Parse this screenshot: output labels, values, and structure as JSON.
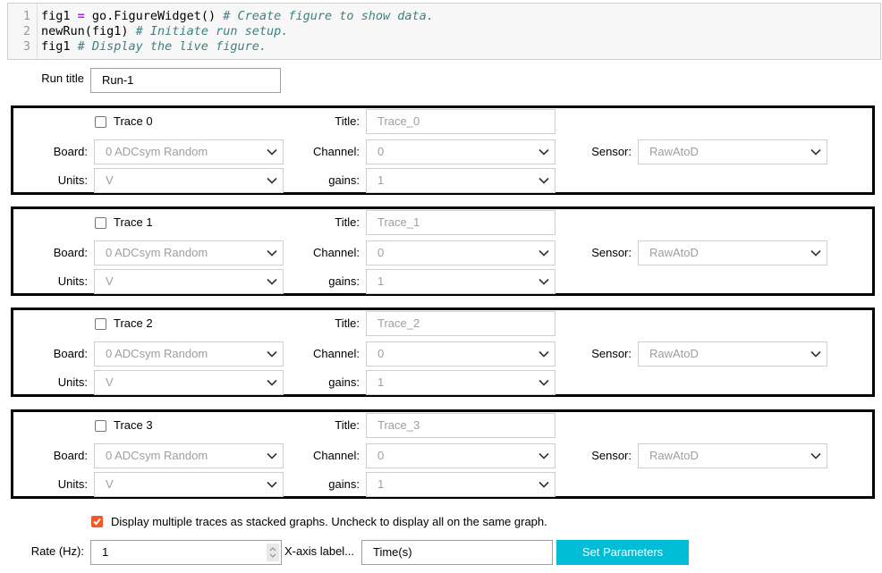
{
  "code": {
    "line_numbers": [
      "1",
      "2",
      "3"
    ],
    "lines": [
      {
        "pre": "fig1 ",
        "op": "=",
        "code": " go.FigureWidget() ",
        "comment": "# Create figure to show data."
      },
      {
        "pre": "",
        "op": "",
        "code": "newRun(fig1) ",
        "comment": "# Initiate run setup."
      },
      {
        "pre": "",
        "op": "",
        "code": "fig1 ",
        "comment": "# Display the live figure."
      }
    ]
  },
  "run_title": {
    "label": "Run title",
    "value": "Run-1"
  },
  "labels": {
    "title": "Title:",
    "board": "Board:",
    "channel": "Channel:",
    "sensor": "Sensor:",
    "units": "Units:",
    "gains": "gains:"
  },
  "traces": [
    {
      "label": "Trace 0",
      "checked": false,
      "title": "Trace_0",
      "board": "0 ADCsym Random",
      "channel": "0",
      "sensor": "RawAtoD",
      "units": "V",
      "gains": "1"
    },
    {
      "label": "Trace 1",
      "checked": false,
      "title": "Trace_1",
      "board": "0 ADCsym Random",
      "channel": "0",
      "sensor": "RawAtoD",
      "units": "V",
      "gains": "1"
    },
    {
      "label": "Trace 2",
      "checked": false,
      "title": "Trace_2",
      "board": "0 ADCsym Random",
      "channel": "0",
      "sensor": "RawAtoD",
      "units": "V",
      "gains": "1"
    },
    {
      "label": "Trace 3",
      "checked": false,
      "title": "Trace_3",
      "board": "0 ADCsym Random",
      "channel": "0",
      "sensor": "RawAtoD",
      "units": "V",
      "gains": "1"
    }
  ],
  "stacked": {
    "label": "Display multiple traces as stacked graphs. Uncheck to display all on the same graph.",
    "checked": true
  },
  "rate": {
    "label": "Rate (Hz):",
    "value": "1"
  },
  "xaxis": {
    "label": "X-axis label...",
    "value": "Time(s)"
  },
  "set_button": "Set Parameters",
  "colors": {
    "accent": "#00bcd4",
    "checkbox": "#f1592a"
  }
}
